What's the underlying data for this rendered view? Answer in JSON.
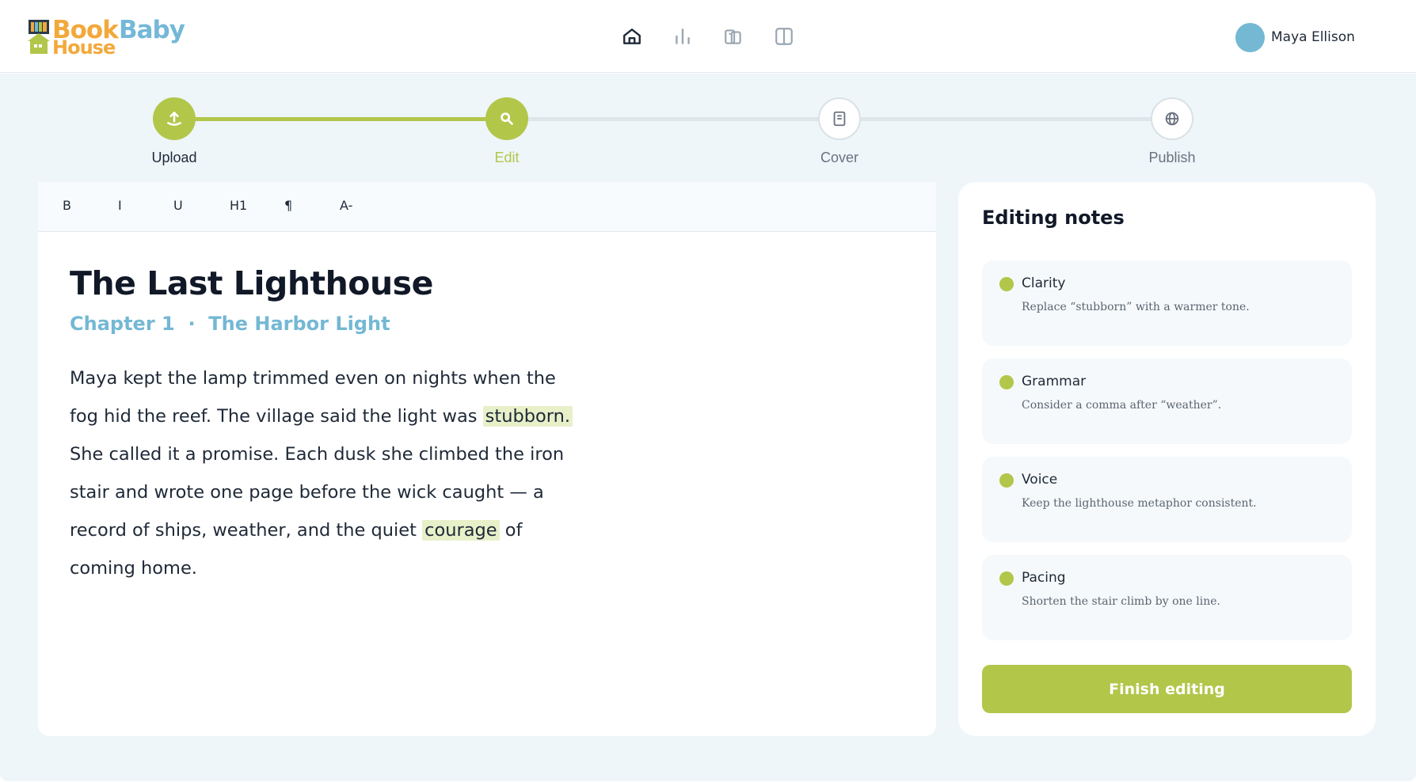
{
  "app": {
    "logo_lines": [
      "Book",
      "Baby",
      "House"
    ]
  },
  "header": {
    "nav": [
      {
        "icon": "home-icon",
        "label": "Home"
      },
      {
        "icon": "bar-chart-icon",
        "label": "Stats"
      },
      {
        "icon": "library-icon",
        "label": "Library"
      },
      {
        "icon": "book-open-icon",
        "label": "Reader"
      }
    ],
    "user": {
      "name": "Maya Ellison"
    }
  },
  "stepper": {
    "steps": [
      {
        "label": "Upload",
        "state": "done",
        "icon": "upload-icon"
      },
      {
        "label": "Edit",
        "state": "current",
        "icon": "search-icon"
      },
      {
        "label": "Cover",
        "state": "pending",
        "icon": "document-icon"
      },
      {
        "label": "Publish",
        "state": "pending",
        "icon": "globe-icon"
      }
    ]
  },
  "toolbar": {
    "bold": "B",
    "italic": "I",
    "underline": "U",
    "heading": "H1",
    "paragraph": "¶",
    "font_smaller": "A-"
  },
  "document": {
    "title": "The Last Lighthouse",
    "chapter_number": "Chapter 1",
    "chapter_separator": "·",
    "chapter_name": "The Harbor Light",
    "body": {
      "part1": "Maya kept the lamp trimmed even on nights when the fog hid the reef. The village said the light was ",
      "highlight1": "stubborn.",
      "part2": " She called it a promise. Each dusk she climbed the iron stair and wrote one page before the wick caught — a record of ships, weather, and the quiet ",
      "highlight2": "courage",
      "part3": " of coming home."
    }
  },
  "notes": {
    "title": "Editing notes",
    "items": [
      {
        "category": "Clarity",
        "text": "Replace “stubborn” with a warmer tone."
      },
      {
        "category": "Grammar",
        "text": "Consider a comma after “weather”."
      },
      {
        "category": "Voice",
        "text": "Keep the lighthouse metaphor consistent."
      },
      {
        "category": "Pacing",
        "text": "Shorten the stair climb by one line."
      }
    ],
    "finish_label": "Finish editing"
  },
  "colors": {
    "accent_green": "#b2c64a",
    "accent_blue": "#74b8d4",
    "highlight": "#e7f0c9",
    "background": "#eef6fa",
    "logo_orange": "#f2a93b"
  }
}
